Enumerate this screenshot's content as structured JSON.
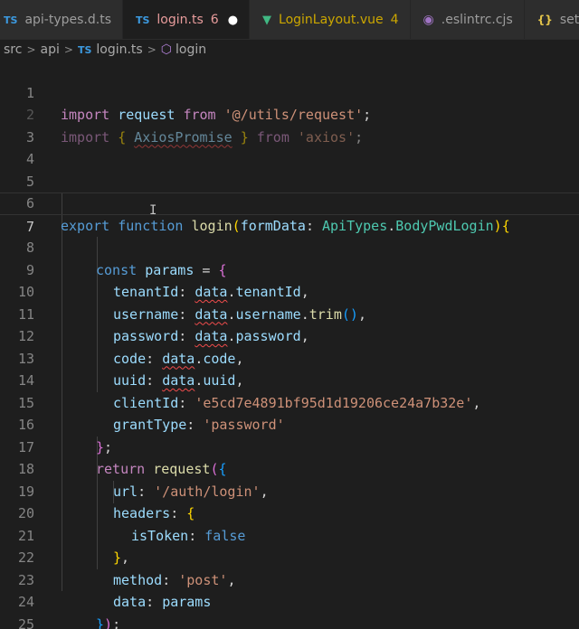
{
  "tabs": [
    {
      "icon": "TS",
      "label": "api-types.d.ts",
      "type": "ts"
    },
    {
      "icon": "TS",
      "label": "login.ts",
      "type": "ts",
      "badge": "6",
      "active": true
    },
    {
      "icon": "▼",
      "label": "LoginLayout.vue",
      "type": "vue",
      "badge": "4"
    },
    {
      "icon": "◉",
      "label": ".eslintrc.cjs",
      "type": "eslint"
    },
    {
      "icon": "{}",
      "label": "settings.json",
      "type": "json"
    }
  ],
  "breadcrumb": {
    "parts": [
      "src",
      "api"
    ],
    "file_icon": "TS",
    "file": "login.ts",
    "symbol_icon": "⬡",
    "symbol": "login"
  },
  "editor": {
    "line_numbers": [
      "1",
      "2",
      "3",
      "4",
      "5",
      "6",
      "7",
      "8",
      "9",
      "10",
      "11",
      "12",
      "13",
      "14",
      "15",
      "16",
      "17",
      "18",
      "19",
      "20",
      "21",
      "22",
      "23",
      "24",
      "25"
    ],
    "active_line": "7",
    "tokens": {
      "import": "import",
      "request": "request",
      "from": "from",
      "utils_path": "'@/utils/request'",
      "semi": ";",
      "lbrace": "{",
      "rbrace": "}",
      "axios_promise": "AxiosPromise",
      "axios": "'axios'",
      "export": "export",
      "function": "function",
      "login": "login",
      "lparen": "(",
      "rparen": ")",
      "form_data": "formData",
      "colon": ":",
      "api_types": "ApiTypes",
      "dot": ".",
      "body_pwd_login": "BodyPwdLogin",
      "const": "const",
      "params": "params",
      "equals": "=",
      "comma": ",",
      "tenant_id": "tenantId",
      "data": "data",
      "username": "username",
      "trim": "trim",
      "password": "password",
      "code": "code",
      "uuid": "uuid",
      "client_id": "clientId",
      "client_id_value": "'e5cd7e4891bf95d1d19206ce24a7b32e'",
      "grant_type": "grantType",
      "password_str": "'password'",
      "return": "return",
      "url": "url",
      "url_value": "'/auth/login'",
      "headers": "headers",
      "is_token": "isToken",
      "false": "false",
      "method": "method",
      "post": "'post'"
    }
  },
  "cursor_glyph": "I"
}
